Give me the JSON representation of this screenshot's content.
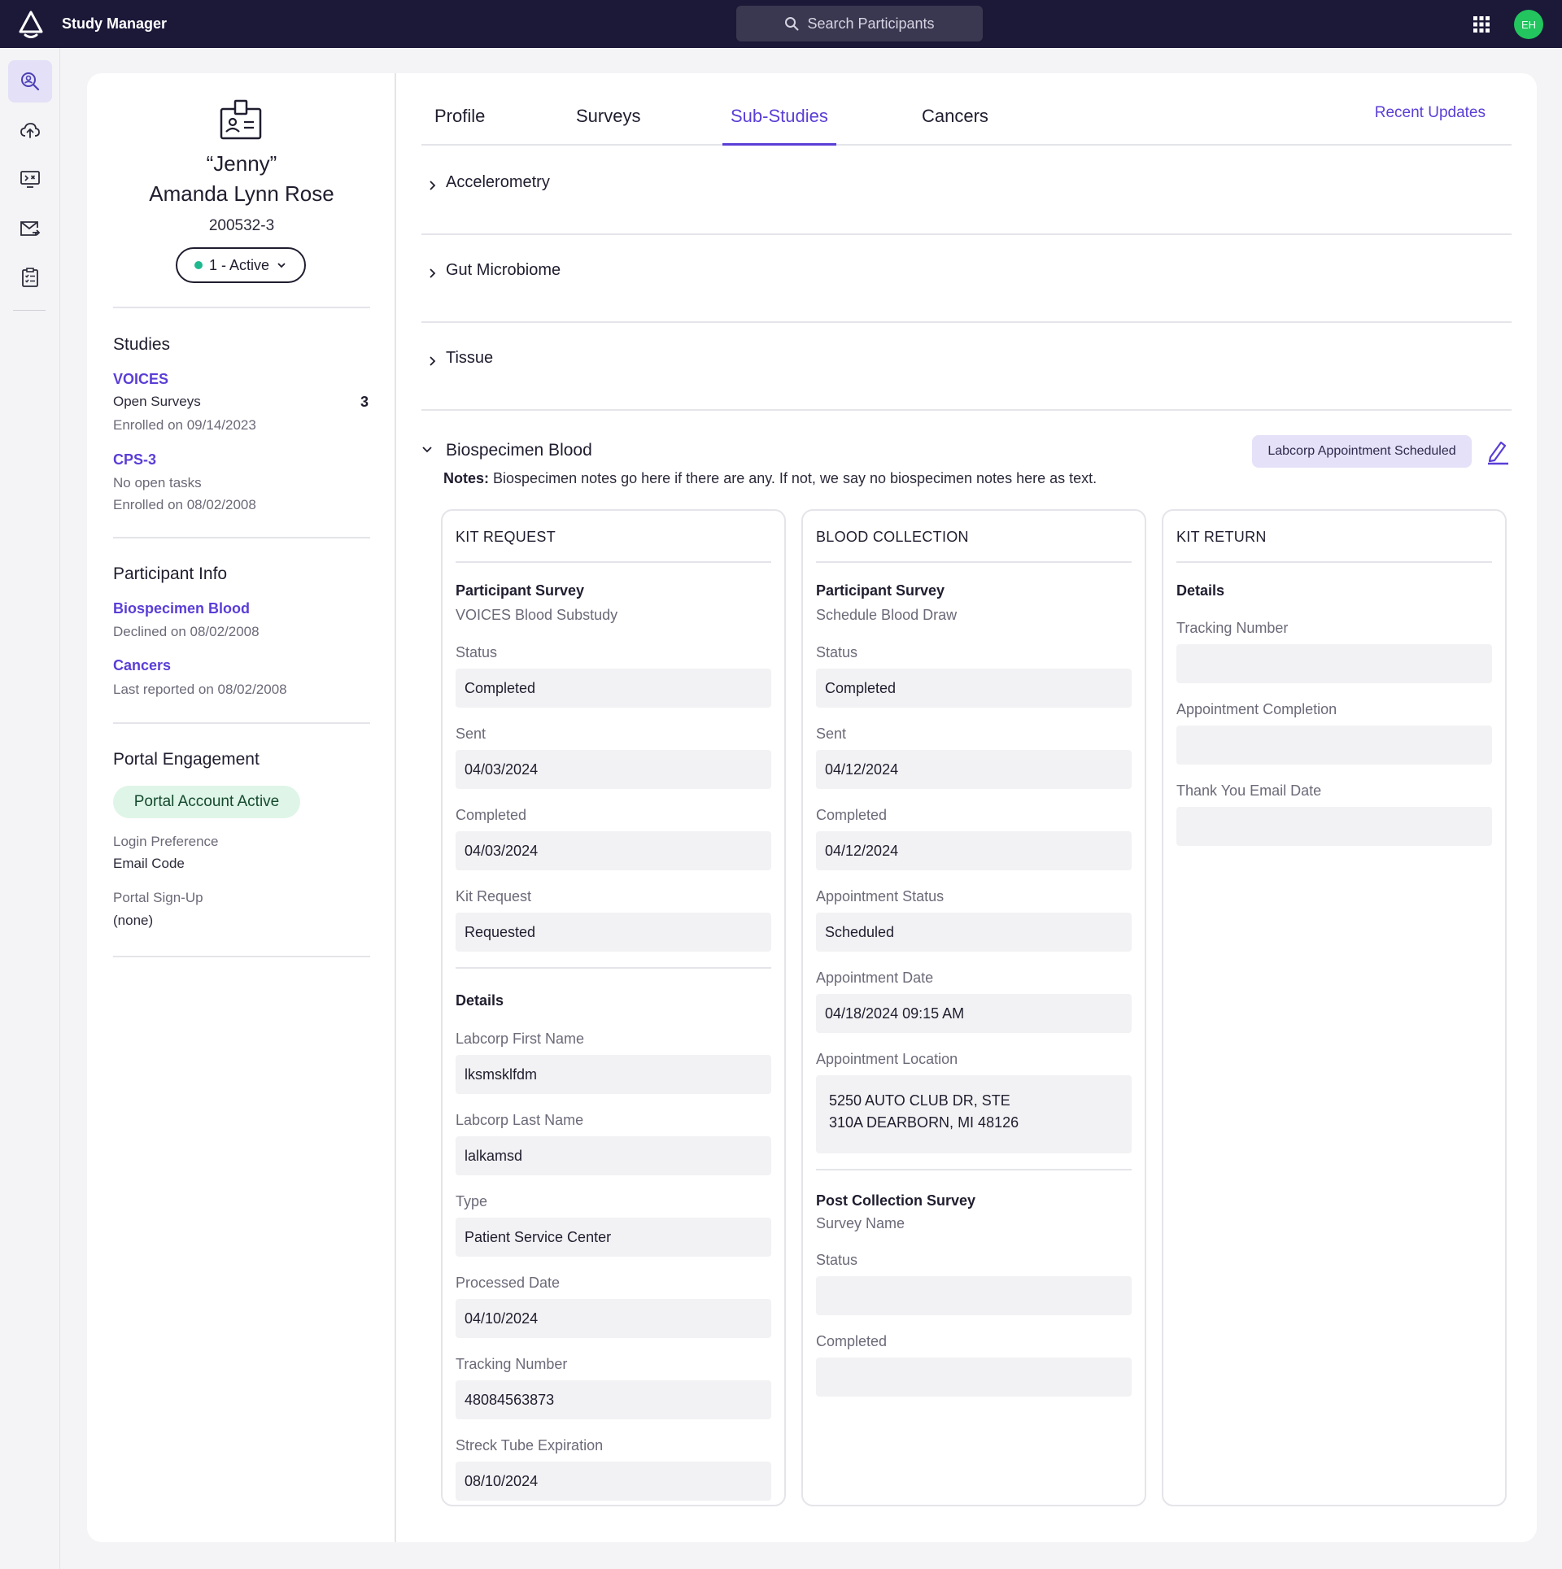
{
  "header": {
    "app_title": "Study Manager",
    "search_label": "Search Participants",
    "avatar_initials": "EH",
    "colors": {
      "bar": "#1b1838",
      "accent": "#5b3ed6",
      "avatar": "#22c55e"
    }
  },
  "rail": {
    "items": [
      {
        "icon": "participant-search-icon",
        "active": true
      },
      {
        "icon": "cloud-upload-icon"
      },
      {
        "icon": "message-screen-icon"
      },
      {
        "icon": "mail-send-icon"
      },
      {
        "icon": "clipboard-checklist-icon"
      }
    ]
  },
  "participant": {
    "nickname": "“Jenny”",
    "full_name": "Amanda Lynn Rose",
    "id": "200532-3",
    "status": "1 - Active"
  },
  "studies": {
    "title": "Studies",
    "items": [
      {
        "name": "VOICES",
        "line1": "Open Surveys",
        "count": "3",
        "enrolled": "Enrolled on 09/14/2023"
      },
      {
        "name": "CPS-3",
        "line1": "No open tasks",
        "enrolled": "Enrolled on 08/02/2008"
      }
    ]
  },
  "participant_info": {
    "title": "Participant Info",
    "items": [
      {
        "name": "Biospecimen Blood",
        "detail": "Declined on 08/02/2008"
      },
      {
        "name": "Cancers",
        "detail": "Last reported on 08/02/2008"
      }
    ]
  },
  "portal": {
    "title": "Portal Engagement",
    "badge": "Portal Account Active",
    "login_label": "Login Preference",
    "login_value": "Email Code",
    "signup_label": "Portal Sign-Up",
    "signup_value": "(none)"
  },
  "tabs": {
    "items": [
      "Profile",
      "Surveys",
      "Sub-Studies",
      "Cancers"
    ],
    "active": "Sub-Studies",
    "recent_updates": "Recent Updates"
  },
  "substudies": {
    "collapsed": [
      "Accelerometry",
      "Gut Microbiome",
      "Tissue"
    ],
    "expanded": {
      "title": "Biospecimen Blood",
      "badge": "Labcorp Appointment Scheduled",
      "notes_label": "Notes:",
      "notes_text": "Biospecimen notes go here if there are any. If not, we say no biospecimen notes here as text."
    }
  },
  "kit_request": {
    "heading": "KIT REQUEST",
    "survey_label": "Participant Survey",
    "survey_name": "VOICES Blood Substudy",
    "status_label": "Status",
    "status": "Completed",
    "sent_label": "Sent",
    "sent": "04/03/2024",
    "completed_label": "Completed",
    "completed": "04/03/2024",
    "kit_request_label": "Kit Request",
    "kit_request": "Requested",
    "details_label": "Details",
    "first_name_label": "Labcorp First Name",
    "first_name": "lksmsklfdm",
    "last_name_label": "Labcorp Last Name",
    "last_name": "lalkamsd",
    "type_label": "Type",
    "type": "Patient Service Center",
    "processed_label": "Processed Date",
    "processed": "04/10/2024",
    "tracking_label": "Tracking Number",
    "tracking": "48084563873",
    "streck_label": "Streck Tube Expiration",
    "streck": "08/10/2024"
  },
  "blood_collection": {
    "heading": "BLOOD COLLECTION",
    "survey_label": "Participant Survey",
    "survey_name": "Schedule Blood Draw",
    "status_label": "Status",
    "status": "Completed",
    "sent_label": "Sent",
    "sent": "04/12/2024",
    "completed_label": "Completed",
    "completed": "04/12/2024",
    "appt_status_label": "Appointment Status",
    "appt_status": "Scheduled",
    "appt_date_label": "Appointment Date",
    "appt_date": "04/18/2024 09:15 AM",
    "appt_location_label": "Appointment Location",
    "appt_location": "5250 AUTO CLUB DR, STE\n310A DEARBORN, MI 48126",
    "post_label": "Post Collection Survey",
    "post_survey_name": "Survey Name",
    "post_status_label": "Status",
    "post_status": "",
    "post_completed_label": "Completed",
    "post_completed": ""
  },
  "kit_return": {
    "heading": "KIT RETURN",
    "details_label": "Details",
    "tracking_label": "Tracking Number",
    "tracking": "",
    "appt_completion_label": "Appointment Completion",
    "appt_completion": "",
    "thank_you_label": "Thank You Email Date",
    "thank_you": ""
  }
}
